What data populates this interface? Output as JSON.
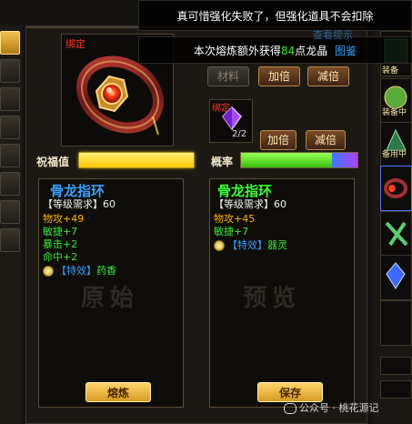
{
  "notifications": {
    "line1": "真可惜强化失败了，但强化道具不会扣除",
    "line2_prefix": "本次熔炼额外获得",
    "line2_number": "84",
    "line2_suffix": "点龙晶",
    "line2_link": "图鉴",
    "hint_link": "查看提示"
  },
  "main_item": {
    "bind_tag": "绑定",
    "material_label": "材料",
    "double_label": "加倍",
    "reduce_label": "减倍"
  },
  "material_slot": {
    "bind_tag": "绑定",
    "count": "2/2",
    "double_label": "加倍",
    "reduce_label": "减倍"
  },
  "bars": {
    "bless_label": "祝福值",
    "rate_label": "概率",
    "bless_fill": 1.0,
    "rate_fill": 0.78
  },
  "left_card": {
    "title": "骨龙指环",
    "level_req": "【等级需求】60",
    "stats": [
      "物攻+49",
      "敏捷+7",
      "暴击+2",
      "命中+2"
    ],
    "effect_label": "【特效】",
    "effect_value": "药香",
    "watermark": "原始",
    "button": "熔炼"
  },
  "right_card": {
    "title": "骨龙指环",
    "level_req": "【等级需求】60",
    "stats": [
      "物攻+45",
      "敏捷+7"
    ],
    "effect_label": "【特效】",
    "effect_value": "器灵",
    "watermark": "预览",
    "button": "保存"
  },
  "side_panel": {
    "slot1": "装备",
    "slot2": "装备中",
    "slot3": "备用中"
  },
  "footer": {
    "watermark_text": "公众号 · 桃花源记"
  },
  "colors": {
    "title_blue": "#3aa0ff",
    "title_green": "#38ff38",
    "stat_gold": "#ffb400",
    "stat_green": "#38e838",
    "bless_bar": "#ffd21a",
    "rate_bar": "#4cd91e"
  }
}
